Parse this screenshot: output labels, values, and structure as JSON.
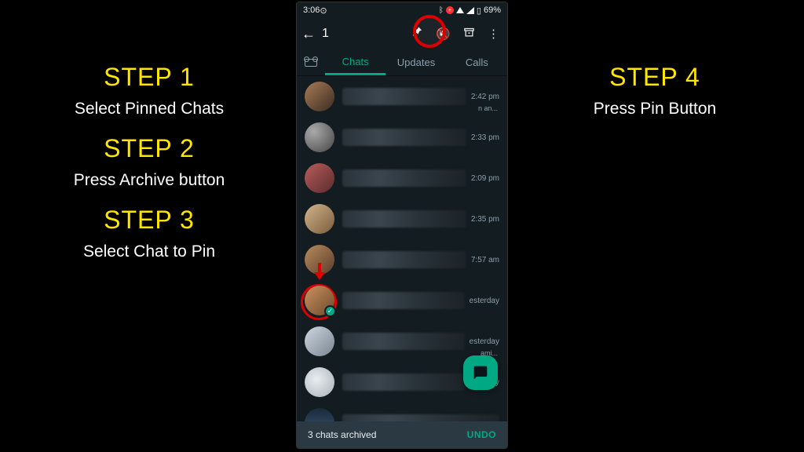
{
  "left_steps": [
    {
      "title": "STEP 1",
      "desc": "Select Pinned Chats"
    },
    {
      "title": "STEP 2",
      "desc": "Press Archive button"
    },
    {
      "title": "STEP 3",
      "desc": "Select Chat to Pin"
    }
  ],
  "right_steps": [
    {
      "title": "STEP 4",
      "desc": "Press Pin Button"
    }
  ],
  "statusbar": {
    "time": "3:06",
    "battery": "69%"
  },
  "topbar": {
    "selected_count": "1"
  },
  "tabs": {
    "chats": "Chats",
    "updates": "Updates",
    "calls": "Calls"
  },
  "chats": [
    {
      "time": "2:42 pm",
      "sub": "n an..."
    },
    {
      "time": "2:33 pm",
      "sub": ""
    },
    {
      "time": "2:09 pm",
      "sub": ""
    },
    {
      "time": "2:35 pm",
      "sub": ""
    },
    {
      "time": "7:57 am",
      "sub": ""
    },
    {
      "time": "esterday",
      "sub": ""
    },
    {
      "time": "esterday",
      "sub": "ami..."
    },
    {
      "time": "esterday",
      "sub": ""
    },
    {
      "time": "",
      "sub": ""
    }
  ],
  "snackbar": {
    "text": "3 chats archived",
    "action": "UNDO"
  }
}
